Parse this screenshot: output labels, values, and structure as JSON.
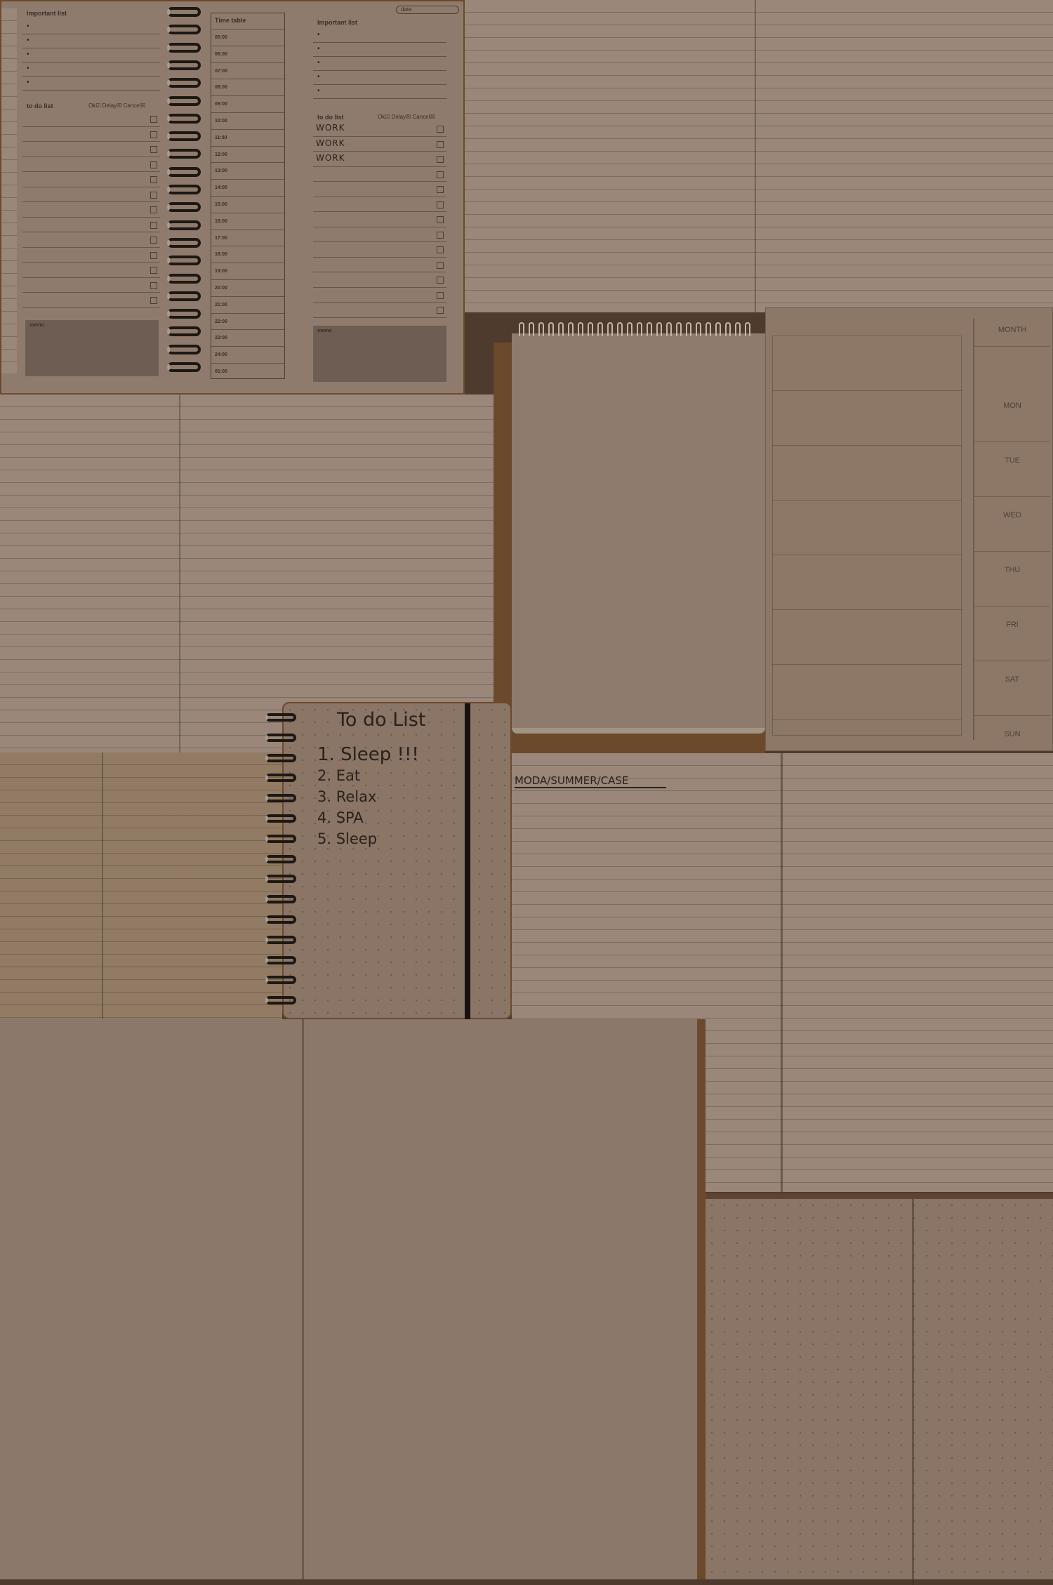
{
  "planner": {
    "date_label": "date",
    "important_list_label": "Important list",
    "todo_list_label": "to do list",
    "status_labels": [
      "Ok",
      "Delay",
      "Cancel"
    ],
    "memo_label": "memo",
    "timetable_label": "Time table",
    "hours": [
      "05:00",
      "06:00",
      "07:00",
      "08:00",
      "09:00",
      "10:00",
      "11:00",
      "12:00",
      "13:00",
      "14:00",
      "15:00",
      "16:00",
      "17:00",
      "18:00",
      "19:00",
      "20:00",
      "21:00",
      "22:00",
      "23:00",
      "24:00",
      "01:00"
    ],
    "handwritten_todos": [
      "WORK",
      "WORK",
      "WORK"
    ]
  },
  "weekly_planner": {
    "days": [
      "MONTH",
      "MON",
      "TUE",
      "WED",
      "THU",
      "FRI",
      "SAT",
      "SUN"
    ]
  },
  "todo_notebook": {
    "title": "To do List",
    "items": [
      "1. Sleep !!!",
      "2. Eat",
      "3. Relax",
      "4. SPA",
      "5. Sleep"
    ]
  },
  "moda_notebook": {
    "heading": "MODA/SUMMER/CASE"
  },
  "colors": {
    "background": "#4e3b2e",
    "paper": "#8f7b6d",
    "kraft": "#6b4a2c"
  }
}
